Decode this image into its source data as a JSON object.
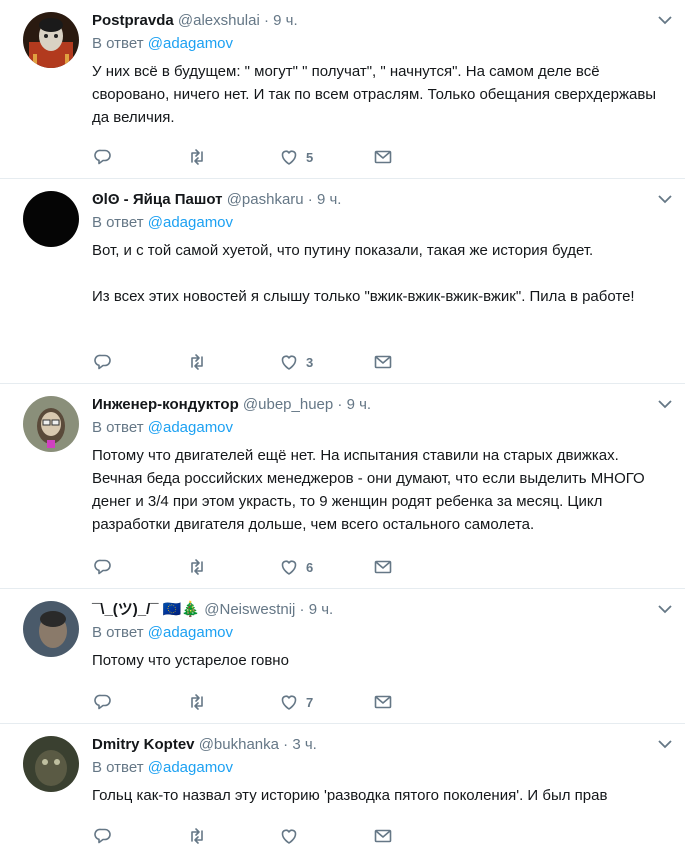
{
  "icons": {
    "reply": "reply-icon",
    "retweet": "retweet-icon",
    "like": "like-icon",
    "message": "message-icon",
    "caret": "chevron-down-icon"
  },
  "colors": {
    "link": "#1da1f2",
    "muted": "#657786",
    "divider": "#e6ecf0"
  },
  "tweets": [
    {
      "name": "Postpravda",
      "handle": "@alexshulai",
      "dot": "·",
      "time": "9 ч.",
      "reply_prefix": "В ответ",
      "reply_to": "@adagamov",
      "text": "У них всё в будущем: \" могут\" \" получат\", \" начнутся\". На самом деле всё сворованo, ничего нет. И так по всем отраслям. Только обещания сверхдержавы да величия.",
      "likes": "5"
    },
    {
      "name": "ʘlʘ - Яйца Пашот",
      "handle": "@pashkaru",
      "dot": "·",
      "time": "9 ч.",
      "reply_prefix": "В ответ",
      "reply_to": "@adagamov",
      "text": "Вот, и с той самой хуетой, что путину показали, такая же история будет.\n\nИз всех этих новостей я слышу только \"вжик-вжик-вжик-вжик\". Пила в работе!",
      "likes": "3"
    },
    {
      "name": "Инженер-кондуктор",
      "handle": "@ubep_huep",
      "dot": "·",
      "time": "9 ч.",
      "reply_prefix": "В ответ",
      "reply_to": "@adagamov",
      "text": "Потому что двигателей ещё нет. На испытания ставили на старых движках. Вечная беда российских менеджеров - они думают, что если выделить МНОГО денег и 3/4 при этом украсть, то 9 женщин родят ребенка за месяц. Цикл разработки двигателя дольше, чем всего остального самолета.",
      "likes": "6"
    },
    {
      "name": "¯\\_(ツ)_/¯ 🇪🇺🎄",
      "handle": "@Neiswestnij",
      "dot": "·",
      "time": "9 ч.",
      "reply_prefix": "В ответ",
      "reply_to": "@adagamov",
      "text": "Потому что устарелое говно",
      "likes": "7"
    },
    {
      "name": "Dmitry Koptev",
      "handle": "@bukhanka",
      "dot": "·",
      "time": "3 ч.",
      "reply_prefix": "В ответ",
      "reply_to": "@adagamov",
      "text": "Гольц как-то назвал эту историю 'разводка пятого поколения'. И был прав",
      "likes": ""
    }
  ]
}
